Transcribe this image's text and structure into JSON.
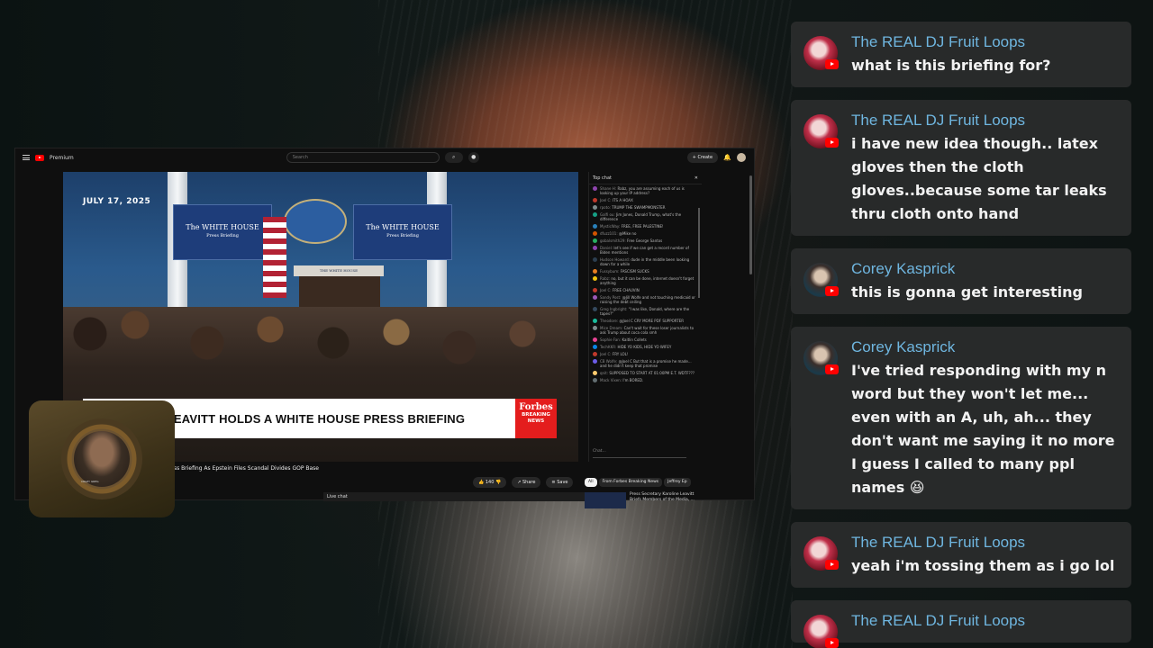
{
  "youtube": {
    "brand": "Premium",
    "search_placeholder": "Search",
    "create_label": "Create",
    "video": {
      "date": "JULY 17, 2025",
      "podium_text": "THE WHITE HOUSE",
      "panel_title": "The WHITE HOUSE",
      "panel_sub": "Press Briefing",
      "headline": "E LEAVITT HOLDS A WHITE HOUSE PRESS BRIEFING",
      "forbes_logo": "Forbes",
      "forbes_tag1": "BREAKING",
      "forbes_tag2": "NEWS",
      "title": "ress Briefing As Epstein Files Scandal Divides GOP Base",
      "likes": "140",
      "share_label": "Share",
      "save_label": "Save"
    },
    "live_chat": {
      "header": "Top chat",
      "input_placeholder": "Chat...",
      "tab_label": "Live chat",
      "messages": [
        {
          "user": "Shane H:",
          "text": "Rabz, you are assuming each of us is looking up your IP address?",
          "color": "#8e44ad"
        },
        {
          "user": "Joel C:",
          "text": "ITS A HOAX",
          "color": "#c0392b"
        },
        {
          "user": "rpoto:",
          "text": "TRUMP THE SWAMPMONSTER",
          "color": "#7f8c8d"
        },
        {
          "user": "Galfi ou:",
          "text": "Jim Jones, Donald Trump, what's the difference",
          "color": "#16a085"
        },
        {
          "user": "MysticWay:",
          "text": "FREE, FREE PALESTINE!",
          "color": "#2980b9"
        },
        {
          "user": "dfuzz101:",
          "text": "@Mike no",
          "color": "#d35400"
        },
        {
          "user": "gobalsmith29:",
          "text": "Free George Santos",
          "color": "#27ae60"
        },
        {
          "user": "Daniel:",
          "text": "let's see if we can get a record number of Biden mentions",
          "color": "#8e44ad"
        },
        {
          "user": "Hudson Howard:",
          "text": "dude in the middle been looking down for a while",
          "color": "#2c3e50"
        },
        {
          "user": "Fussybum:",
          "text": "FASCISM SUCKS",
          "color": "#e67e22"
        },
        {
          "user": "Rabz:",
          "text": "no, but it can be done, internet doesn't forget anything",
          "color": "#f1c40f"
        },
        {
          "user": "Joel C:",
          "text": "FREE CHAUVIN",
          "color": "#c0392b"
        },
        {
          "user": "Sandy Post:",
          "text": "@Jill Wolfe and not touching medicaid or raising the debt ceiling",
          "color": "#9b59b6"
        },
        {
          "user": "Greg Ingbright:",
          "text": "\"I was like, Donald, where are the tapes?\"",
          "color": "#34495e"
        },
        {
          "user": "Theodore:",
          "text": "@Joel C CRY MORE PDF SUPPORTER",
          "color": "#1abc9c"
        },
        {
          "user": "Mice Dream:",
          "text": "Can't wait for these loser journalists to ask Trump about coca cola smh",
          "color": "#7f8c8d"
        },
        {
          "user": "Sophie Fan:",
          "text": "Kaitlin Collets",
          "color": "#e84393"
        },
        {
          "user": "TechKKR:",
          "text": "HIDE YO KIDS, HIDE YO WIFEY",
          "color": "#0984e3"
        },
        {
          "user": "Joel C:",
          "text": "FRY LOL!",
          "color": "#c0392b"
        },
        {
          "user": "CB Wolfe:",
          "text": "@Joel C But that is a promise he made... and he didn't keep that promise",
          "color": "#6c5ce7"
        },
        {
          "user": "qnit:",
          "text": "SUPPOSED TO START AT 01:00PM E.T. WDTF???",
          "color": "#fdcb6e"
        },
        {
          "user": "Mack Vixen:",
          "text": "I'm BORED.",
          "color": "#636e72"
        }
      ]
    },
    "side": {
      "chips": [
        "All",
        "From Forbes Breaking News",
        "Jeffrey Ep"
      ],
      "rec_title": "Press Secretary Karoline Leavitt Briefs Members of the Media, ..."
    }
  },
  "webcam": {
    "label": "CRAZY GREG"
  },
  "chat": [
    {
      "name": "The REAL DJ Fruit Loops",
      "avatar": "dj",
      "message": "what is this briefing for?"
    },
    {
      "name": "The REAL DJ Fruit Loops",
      "avatar": "dj",
      "message": "i have new idea though.. latex gloves then the cloth gloves..because some tar leaks thru cloth onto hand"
    },
    {
      "name": "Corey Kasprick",
      "avatar": "cory",
      "message": "this is gonna get interesting"
    },
    {
      "name": "Corey Kasprick",
      "avatar": "cory",
      "message": "I've tried responding with my n word but they won't let me... even with an A, uh, ah... they don't want me saying it no more I guess I called to many ppl names 😆"
    },
    {
      "name": "The REAL DJ Fruit Loops",
      "avatar": "dj",
      "message": "yeah i'm tossing them as i go lol"
    },
    {
      "name": "The REAL DJ Fruit Loops",
      "avatar": "dj",
      "message": ""
    }
  ],
  "colors": {
    "chat_name": "#6fb6e0",
    "chat_card_bg": "#2a2c2c",
    "youtube_red": "#ff0000",
    "forbes_red": "#e41d1d"
  }
}
